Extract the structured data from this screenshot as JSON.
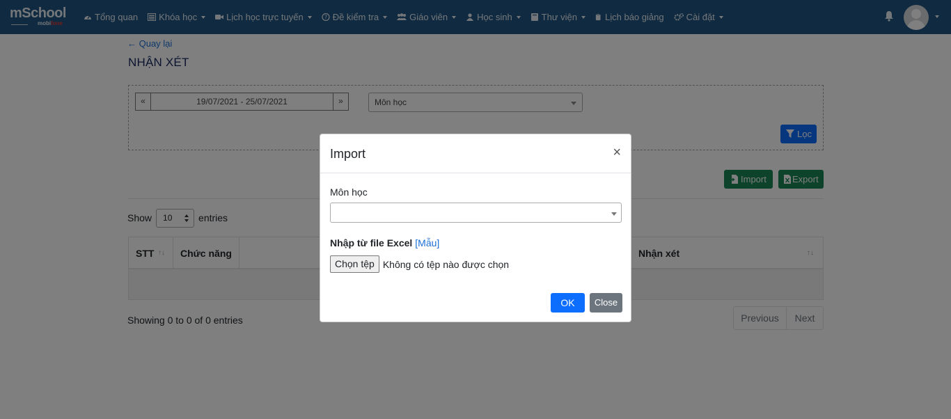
{
  "app": {
    "logo_text": "mSchool",
    "logo_sub_prefix": "mobi",
    "logo_sub_brand": "fone"
  },
  "nav": {
    "items": [
      {
        "label": "Tổng quan",
        "icon": "dashboard-icon",
        "caret": false
      },
      {
        "label": "Khóa học",
        "icon": "list-icon",
        "caret": true
      },
      {
        "label": "Lịch học trực tuyến",
        "icon": "video-icon",
        "caret": true
      },
      {
        "label": "Đề kiểm tra",
        "icon": "question-icon",
        "caret": true
      },
      {
        "label": "Giáo viên",
        "icon": "users-icon",
        "caret": true
      },
      {
        "label": "Học sinh",
        "icon": "user-icon",
        "caret": true
      },
      {
        "label": "Thư viện",
        "icon": "book-icon",
        "caret": true
      },
      {
        "label": "Lịch báo giảng",
        "icon": "clipboard-icon",
        "caret": false
      },
      {
        "label": "Cài đặt",
        "icon": "cogs-icon",
        "caret": true
      }
    ]
  },
  "page": {
    "back_label": "← Quay lại",
    "title": "NHẬN XÉT",
    "date_range": "19/07/2021 - 25/07/2021",
    "prev_arrow": "«",
    "next_arrow": "»",
    "subject_select": "Môn học",
    "filter_button": "Lọc",
    "import_button": "Import",
    "export_button": "Export",
    "show_label": "Show",
    "show_value": "10",
    "entries_label": "entries",
    "table": {
      "headers": [
        "STT",
        "Chức năng",
        "Nhận xét"
      ]
    },
    "info": "Showing 0 to 0 of 0 entries",
    "previous": "Previous",
    "next": "Next"
  },
  "modal": {
    "title": "Import",
    "close_symbol": "×",
    "subject_label": "Môn học",
    "excel_label": "Nhập từ file Excel",
    "template_link": "[Mẫu]",
    "file_button": "Chọn tệp",
    "file_status": "Không có tệp nào được chọn",
    "ok_button": "OK",
    "close_button": "Close"
  },
  "colors": {
    "nav_bg": "#1e5582",
    "primary": "#0d6efd",
    "success": "#198754",
    "secondary": "#6c757d",
    "title": "#1b2a63"
  }
}
